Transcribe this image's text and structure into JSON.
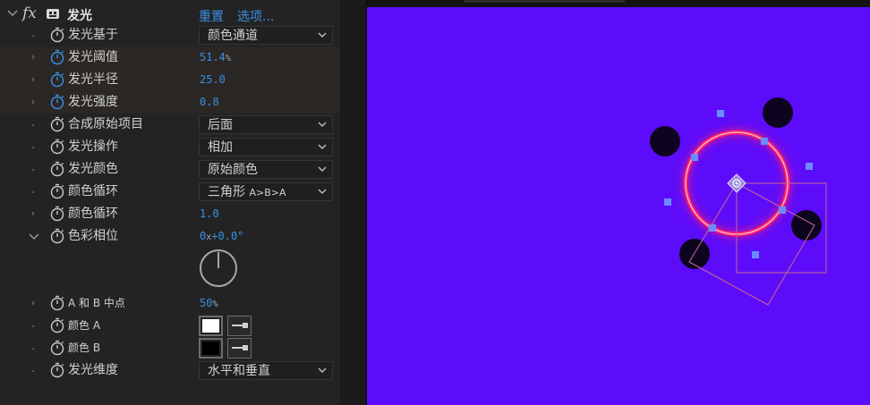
{
  "effect": {
    "fx_label": "fx",
    "name": "发光",
    "reset": "重置",
    "options": "选项..."
  },
  "properties": [
    {
      "label": "发光基于",
      "dropdown": "颜色通道"
    },
    {
      "label": "发光阈值",
      "value": "51.4",
      "unit": "%"
    },
    {
      "label": "发光半径",
      "value": "25.0"
    },
    {
      "label": "发光强度",
      "value": "0.8"
    },
    {
      "label": "合成原始项目",
      "dropdown": "后面"
    },
    {
      "label": "发光操作",
      "dropdown": "相加"
    },
    {
      "label": "发光颜色",
      "dropdown": "原始颜色"
    },
    {
      "label": "颜色循环",
      "dropdown": "三角形",
      "dropdown_sub": "A>B>A"
    },
    {
      "label": "颜色循环",
      "value": "1.0"
    },
    {
      "label": "色彩相位",
      "value_rev": "0",
      "value_x": "x",
      "value_deg": "+0.0°"
    },
    {
      "label": "A 和 B 中点",
      "value": "50",
      "unit": "%"
    },
    {
      "label": "颜色 A",
      "swatch_color": "#ffffff"
    },
    {
      "label": "颜色 B",
      "swatch_color": "#000000"
    },
    {
      "label": "发光维度",
      "dropdown": "水平和垂直"
    }
  ],
  "colors": {
    "comp_background": "#5d0cfa",
    "value_blue": "#3b8fe6",
    "glow_ring": "#ff2a6a",
    "handle": "#6a8cff"
  },
  "icons": [
    "chevron-down-icon",
    "effect-icon",
    "stopwatch-icon",
    "stopwatch-active-icon",
    "eyedropper-icon",
    "anchor-point-icon",
    "dial-icon"
  ]
}
